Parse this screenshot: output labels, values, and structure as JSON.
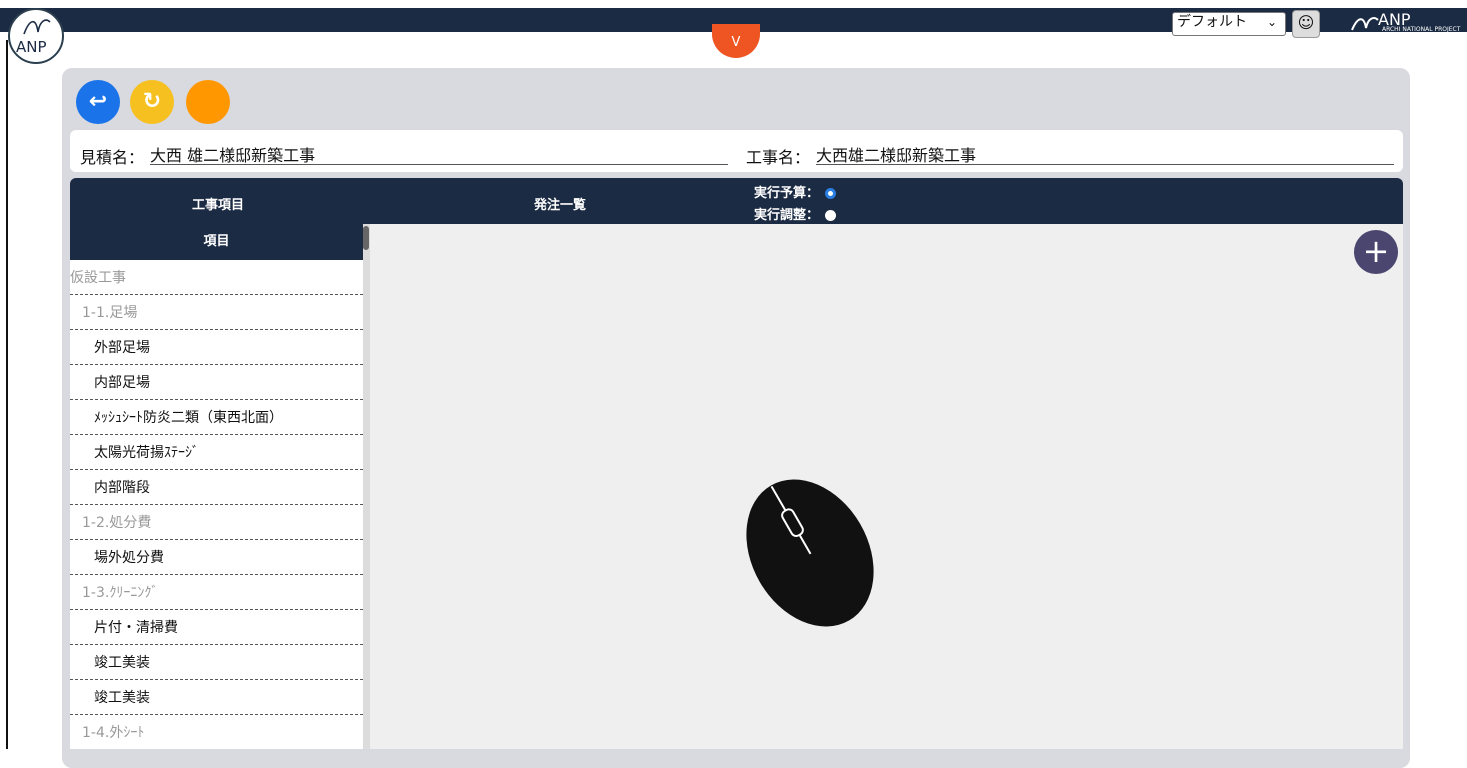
{
  "header": {
    "logo_text": "ANP",
    "drop_tab_label": "V",
    "theme_select_value": "デフォルト",
    "brand_name": "ANP",
    "brand_subtitle": "ARCHI NATIONAL PROJECT"
  },
  "toolbar": {
    "undo_icon": "undo-icon",
    "redo_icon": "redo-icon",
    "undo_glyph": "↩",
    "redo_glyph": "↻"
  },
  "fields": {
    "estimate_label": "見積名：",
    "estimate_value": "大西 雄二様邸新築工事",
    "project_label": "工事名：",
    "project_value": "大西雄二様邸新築工事"
  },
  "columns": {
    "work_items": "工事項目",
    "order_list": "発注一覧",
    "exec_budget": "実行予算：",
    "exec_adjust": "実行調整："
  },
  "list": {
    "header": "項目",
    "items": [
      {
        "text": "仮設工事",
        "level": "cat"
      },
      {
        "text": "1-1.足場",
        "level": "sub"
      },
      {
        "text": "外部足場",
        "level": "leaf"
      },
      {
        "text": "内部足場",
        "level": "leaf"
      },
      {
        "text": "ﾒｯｼｭｼｰﾄ防炎二類（東西北面）",
        "level": "leaf"
      },
      {
        "text": "太陽光荷揚ｽﾃｰｼﾞ",
        "level": "leaf"
      },
      {
        "text": "内部階段",
        "level": "leaf"
      },
      {
        "text": "1-2.処分費",
        "level": "sub"
      },
      {
        "text": "場外処分費",
        "level": "leaf"
      },
      {
        "text": "1-3.ｸﾘｰﾆﾝｸﾞ",
        "level": "sub"
      },
      {
        "text": "片付・清掃費",
        "level": "leaf"
      },
      {
        "text": "竣工美装",
        "level": "leaf"
      },
      {
        "text": "竣工美装",
        "level": "leaf"
      },
      {
        "text": "1-4.外ｼｰﾄ",
        "level": "sub"
      }
    ]
  },
  "colors": {
    "navy": "#1c2b44",
    "accent_orange": "#ee5522",
    "blue": "#1a73e8",
    "yellow": "#f6c020",
    "orange": "#ff9800",
    "add_button": "#4a4670"
  }
}
